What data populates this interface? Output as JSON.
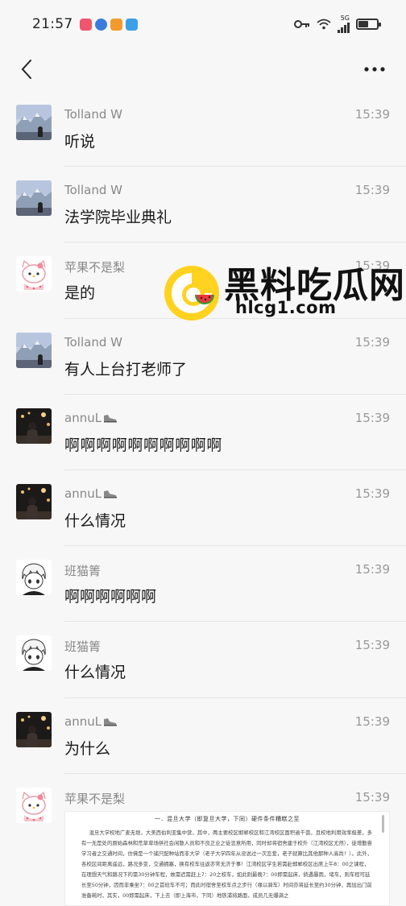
{
  "status_bar": {
    "time": "21:57",
    "app_dots": [
      "#f0556e",
      "#3b7bdc",
      "#f29a2e",
      "#3aa0e8"
    ],
    "network": "5G",
    "battery_level": 0.55
  },
  "nav": {
    "back_icon": "chevron-left-icon",
    "more_icon": "more-dots-icon"
  },
  "messages": [
    {
      "sender": "Tolland W",
      "time": "15:39",
      "text": "听说",
      "avatar": "mountain"
    },
    {
      "sender": "Tolland W",
      "time": "15:39",
      "text": "法学院毕业典礼",
      "avatar": "mountain"
    },
    {
      "sender": "苹果不是梨",
      "time": "15:39",
      "text": "是的",
      "avatar": "kitty"
    },
    {
      "sender": "Tolland W",
      "time": "15:39",
      "text": "有人上台打老师了",
      "avatar": "mountain"
    },
    {
      "sender": "annuL",
      "time": "15:39",
      "text": "啊啊啊啊啊啊啊啊啊啊",
      "avatar": "night",
      "badge": "shoe-icon"
    },
    {
      "sender": "annuL",
      "time": "15:39",
      "text": "什么情况",
      "avatar": "night",
      "badge": "shoe-icon"
    },
    {
      "sender": "班猫箐",
      "time": "15:39",
      "text": "啊啊啊啊啊啊",
      "avatar": "anime"
    },
    {
      "sender": "班猫箐",
      "time": "15:39",
      "text": "什么情况",
      "avatar": "anime"
    },
    {
      "sender": "annuL",
      "time": "15:39",
      "text": "为什么",
      "avatar": "night",
      "badge": "shoe-icon"
    },
    {
      "sender": "苹果不是梨",
      "time": "15:39",
      "text": "",
      "avatar": "kitty"
    }
  ],
  "document_preview": {
    "title": "一．混旦大学（即复旦大学，下同）硬件条件糟糕之至",
    "body": "混旦大学校地广麦无垠，大美西伯利亚集中营，其中，两主要校区邯郸校区和江湾校区面积逾千亩，且校地利用效率极差，多有一无是处的原始森林和荒草草场供社会闲散人员和不良正业之徒恣意所用，同时却将宿舍建于校外（江湾校区尤然），徒增勤奋学习者之交通时间，仿佛是一个捕只配种站而非大学（老子大学四年从没说过一次恋爱，老子就算比其他那种人高尚！）。此外，各校区间距离遥远，路况多变，交通拥塞，换有校车往返亦常无济于事！江湾校区学生若需赴邯郸校区出席上午8：00之课程，在理想天气和路况下的需30分钟车程，故需迟需赶上7：20之校车，如此则最晚7：00即需起床，倘遇暴雨，堵车，则车程可延长至50分钟，因而非乘坐7：00之首班车不可；而此时宿舍至校车点之步行（缘以骑车）时间亦将延长至约30分钟，再加出门前准备耗时，其实，00即需起床，下上去（即上海市，下同）地铁浦将路面，成员几无爆满之"
  },
  "watermark": {
    "title": "黑料吃瓜网",
    "url": "hlcg1.com"
  }
}
